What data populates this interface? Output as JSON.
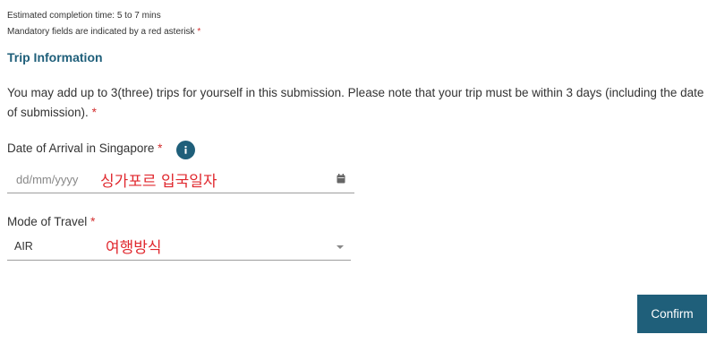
{
  "header": {
    "completion_time": "Estimated completion time: 5 to 7 mins",
    "mandatory_note": "Mandatory fields are indicated by a red asterisk",
    "asterisk": "*"
  },
  "section": {
    "title": "Trip Information",
    "intro": "You may add up to 3(three) trips for yourself in this submission. Please note that your trip must be within 3 days (including the date of submission).",
    "intro_asterisk": "*"
  },
  "arrival": {
    "label": "Date of Arrival in Singapore",
    "asterisk": "*",
    "info_icon": "info-icon",
    "placeholder": "dd/mm/yyyy",
    "annotation": "싱가포르 입국일자",
    "calendar_icon": "calendar-icon"
  },
  "travel_mode": {
    "label": "Mode of Travel",
    "asterisk": "*",
    "value": "AIR",
    "annotation": "여행방식",
    "dropdown_icon": "chevron-down-icon"
  },
  "actions": {
    "confirm_label": "Confirm"
  },
  "colors": {
    "accent": "#1f5f7a",
    "required": "#d32f2f",
    "annotation": "#e0282e"
  }
}
